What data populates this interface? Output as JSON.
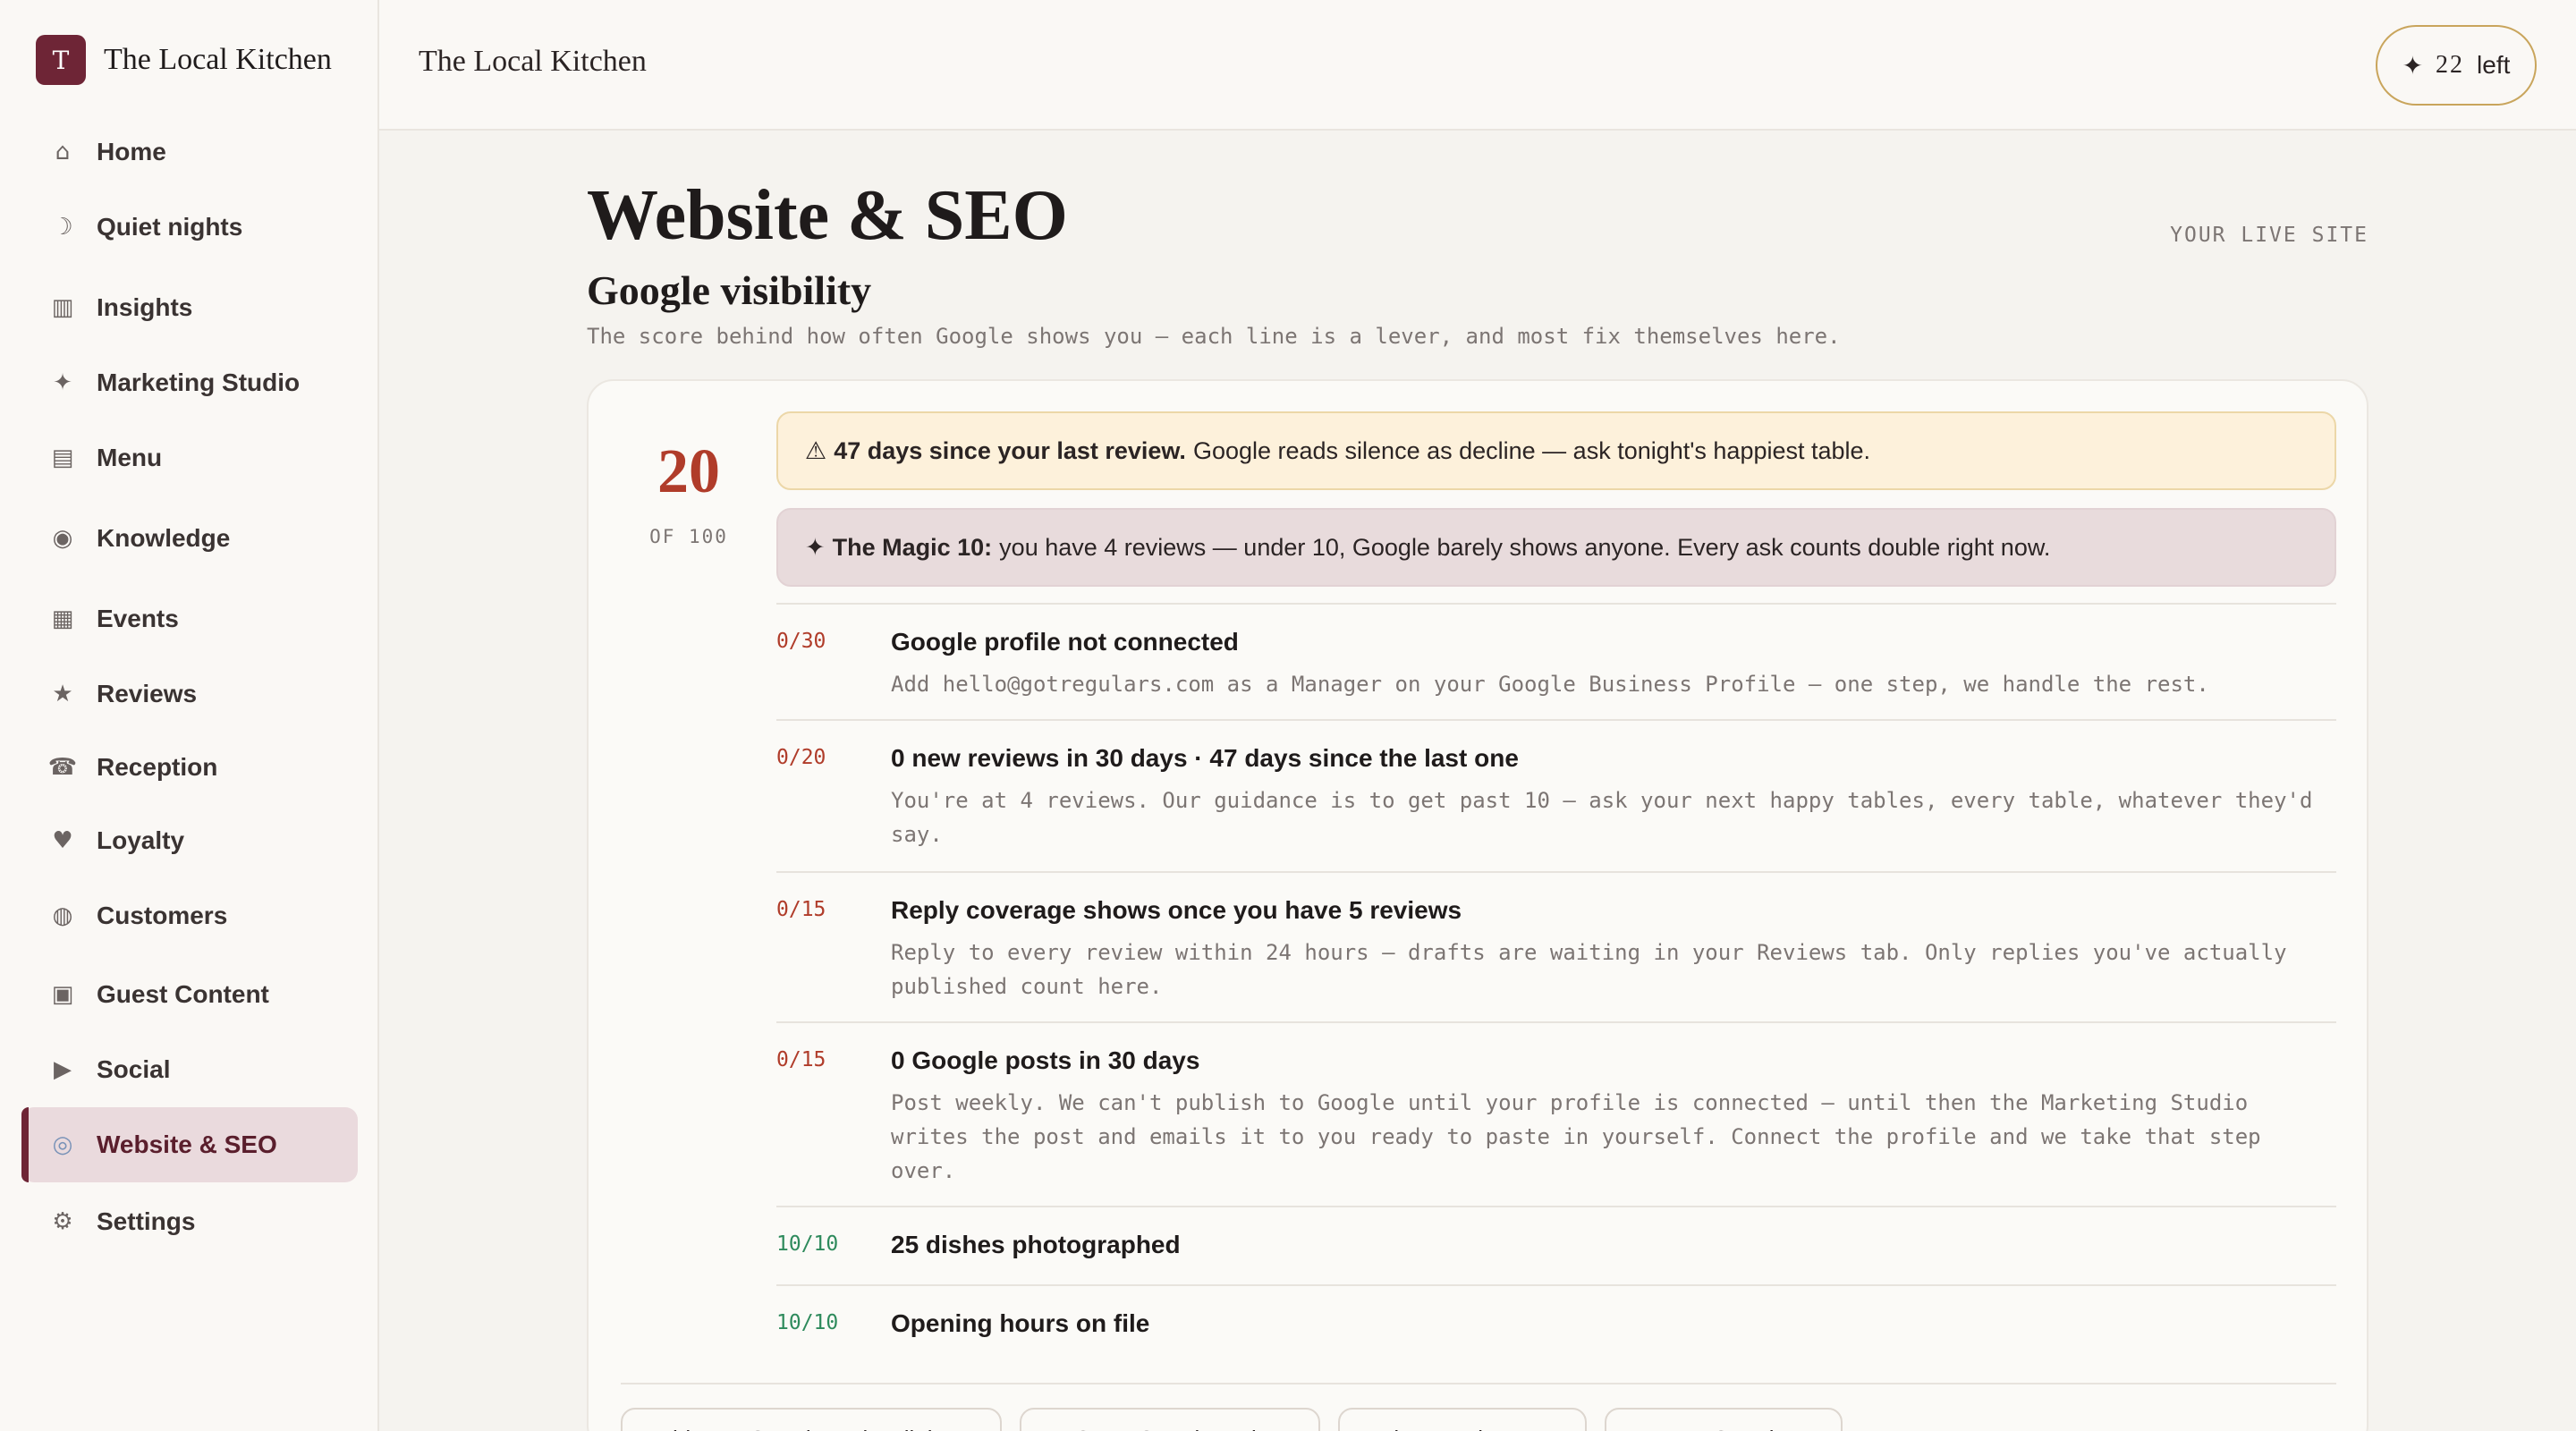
{
  "brand": {
    "logo_letter": "T",
    "name": "The Local Kitchen"
  },
  "sidebar": {
    "items": [
      {
        "icon": "⌂",
        "icon_name": "home-icon",
        "label": "Home"
      },
      {
        "icon": "☽",
        "icon_name": "moon-icon",
        "label": "Quiet nights"
      },
      {
        "icon": "▥",
        "icon_name": "bar-chart-icon",
        "label": "Insights"
      },
      {
        "icon": "✦",
        "icon_name": "sparkle-icon",
        "label": "Marketing Studio"
      },
      {
        "icon": "▤",
        "icon_name": "plate-icon",
        "label": "Menu"
      },
      {
        "icon": "◉",
        "icon_name": "brain-icon",
        "label": "Knowledge"
      },
      {
        "icon": "▦",
        "icon_name": "calendar-icon",
        "label": "Events"
      },
      {
        "icon": "★",
        "icon_name": "star-icon",
        "label": "Reviews"
      },
      {
        "icon": "☎",
        "icon_name": "phone-icon",
        "label": "Reception"
      },
      {
        "icon": "♥",
        "icon_name": "heart-icon",
        "label": "Loyalty"
      },
      {
        "icon": "◍",
        "icon_name": "people-icon",
        "label": "Customers"
      },
      {
        "icon": "▣",
        "icon_name": "clapper-icon",
        "label": "Guest Content"
      },
      {
        "icon": "▶",
        "icon_name": "play-icon",
        "label": "Social"
      },
      {
        "icon": "◎",
        "icon_name": "globe-icon",
        "label": "Website & SEO",
        "active": true
      },
      {
        "icon": "⚙",
        "icon_name": "gear-icon",
        "label": "Settings"
      }
    ]
  },
  "topbar": {
    "title": "The Local Kitchen",
    "credits_icon": "✦",
    "credits_count": "22",
    "credits_suffix": "left"
  },
  "main": {
    "title": "Website & SEO",
    "live_site_label": "YOUR LIVE SITE",
    "section_title": "Google visibility",
    "section_subtitle": "The score behind how often Google shows you — each line is a lever, and most fix themselves here."
  },
  "score": {
    "value": "20",
    "of_label": "OF 100"
  },
  "alerts": {
    "warning": {
      "icon": "⚠",
      "bold": "47 days since your last review.",
      "text": "Google reads silence as decline — ask tonight's happiest table."
    },
    "magic": {
      "icon": "✦",
      "bold": "The Magic 10:",
      "text": "you have 4 reviews — under 10, Google barely shows anyone. Every ask counts double right now."
    }
  },
  "checklist": [
    {
      "points": "0/30",
      "title": "Google profile not connected",
      "description": "Add hello@gotregulars.com as a Manager on your Google Business Profile — one step, we handle the rest."
    },
    {
      "points": "0/20",
      "title": "0 new reviews in 30 days · 47 days since the last one",
      "description": "You're at 4 reviews. Our guidance is to get past 10 — ask your next happy tables, every table, whatever they'd say."
    },
    {
      "points": "0/15",
      "title": "Reply coverage shows once you have 5 reviews",
      "description": "Reply to every review within 24 hours — drafts are waiting in your Reviews tab. Only replies you've actually published count here."
    },
    {
      "points": "0/15",
      "title": "0 Google posts in 30 days",
      "description": "Post weekly. We can't publish to Google until your profile is connected — until then the Marketing Studio writes the post and emails it to you ready to paste in yourself. Connect the profile and we take that step over."
    },
    {
      "points": "10/10",
      "title": "25 dishes photographed",
      "description": ""
    },
    {
      "points": "10/10",
      "title": "Opening hours on file",
      "description": ""
    }
  ],
  "actions": [
    {
      "label": "Add your Google review link →"
    },
    {
      "label": "↗ Open Google reviews"
    },
    {
      "label": "Ask a regular →"
    },
    {
      "label": "Post to Google →"
    }
  ],
  "colors": {
    "brand": "#6e2536",
    "score": "#b03c2a",
    "good": "#2e8a5c",
    "warn_bg": "#fdf1db",
    "magic_bg": "#e8dbdc"
  }
}
